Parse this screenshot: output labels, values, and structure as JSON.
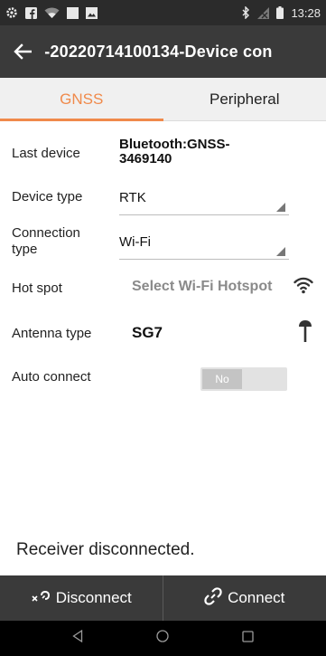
{
  "status_bar": {
    "time": "13:28",
    "icons_left": [
      "settings-icon",
      "facebook-icon",
      "wifi-icon",
      "square-icon",
      "image-icon"
    ],
    "icons_right": [
      "bluetooth-icon",
      "no-signal-icon",
      "battery-icon"
    ]
  },
  "app_bar": {
    "title": " -20220714100134-Device con"
  },
  "tabs": [
    {
      "label": "GNSS",
      "active": true
    },
    {
      "label": "Peripheral",
      "active": false
    }
  ],
  "form": {
    "last_device": {
      "label": "Last device",
      "value": "Bluetooth:GNSS-\n3469140"
    },
    "device_type": {
      "label": "Device type",
      "value": "RTK"
    },
    "connection_type": {
      "label": "Connection\ntype",
      "value": "Wi-Fi"
    },
    "hot_spot": {
      "label": "Hot spot",
      "value": "Select Wi-Fi Hotspot"
    },
    "antenna_type": {
      "label": "Antenna type",
      "value": "SG7"
    },
    "auto_connect": {
      "label": "Auto connect",
      "value": "No"
    }
  },
  "status_message": "Receiver disconnected.",
  "actions": {
    "disconnect": "Disconnect",
    "connect": "Connect"
  },
  "colors": {
    "accent": "#f08a4b",
    "bar": "#3a3a3a"
  }
}
